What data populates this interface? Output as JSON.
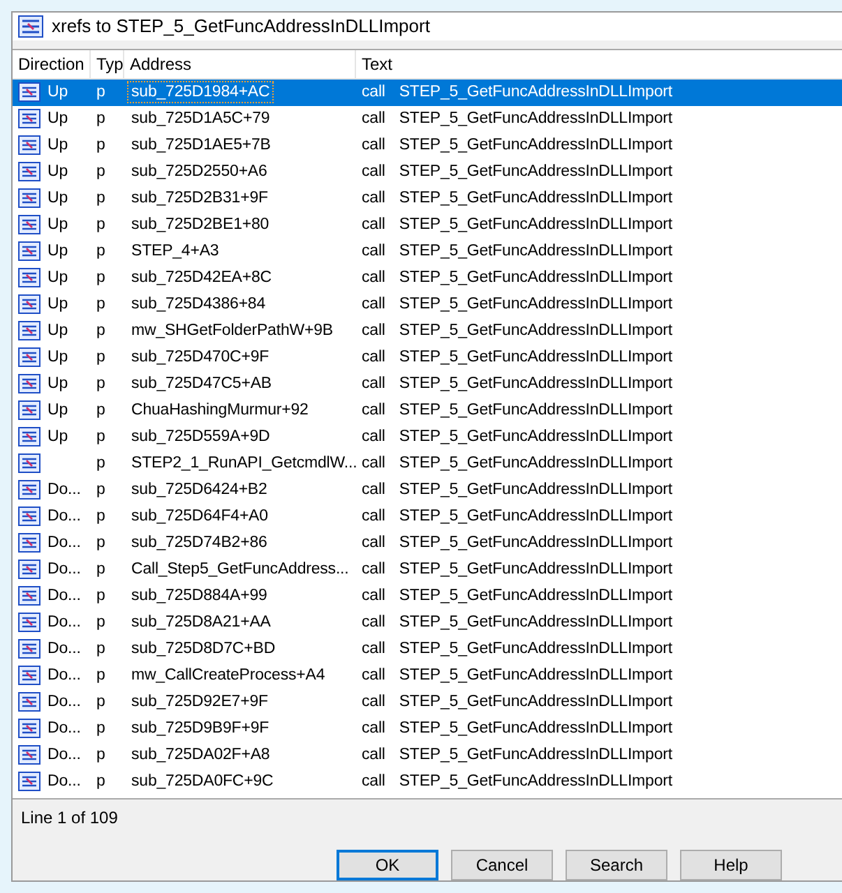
{
  "window": {
    "title": "xrefs to STEP_5_GetFuncAddressInDLLImport"
  },
  "table": {
    "columns": [
      "Direction",
      "Typ",
      "Address",
      "Text"
    ],
    "rows": [
      {
        "direction": "Up",
        "type": "p",
        "address": "sub_725D1984+AC",
        "instruction": "call",
        "target": "STEP_5_GetFuncAddressInDLLImport",
        "selected": true
      },
      {
        "direction": "Up",
        "type": "p",
        "address": "sub_725D1A5C+79",
        "instruction": "call",
        "target": "STEP_5_GetFuncAddressInDLLImport",
        "selected": false
      },
      {
        "direction": "Up",
        "type": "p",
        "address": "sub_725D1AE5+7B",
        "instruction": "call",
        "target": "STEP_5_GetFuncAddressInDLLImport",
        "selected": false
      },
      {
        "direction": "Up",
        "type": "p",
        "address": "sub_725D2550+A6",
        "instruction": "call",
        "target": "STEP_5_GetFuncAddressInDLLImport",
        "selected": false
      },
      {
        "direction": "Up",
        "type": "p",
        "address": "sub_725D2B31+9F",
        "instruction": "call",
        "target": "STEP_5_GetFuncAddressInDLLImport",
        "selected": false
      },
      {
        "direction": "Up",
        "type": "p",
        "address": "sub_725D2BE1+80",
        "instruction": "call",
        "target": "STEP_5_GetFuncAddressInDLLImport",
        "selected": false
      },
      {
        "direction": "Up",
        "type": "p",
        "address": "STEP_4+A3",
        "instruction": "call",
        "target": "STEP_5_GetFuncAddressInDLLImport",
        "selected": false
      },
      {
        "direction": "Up",
        "type": "p",
        "address": "sub_725D42EA+8C",
        "instruction": "call",
        "target": "STEP_5_GetFuncAddressInDLLImport",
        "selected": false
      },
      {
        "direction": "Up",
        "type": "p",
        "address": "sub_725D4386+84",
        "instruction": "call",
        "target": "STEP_5_GetFuncAddressInDLLImport",
        "selected": false
      },
      {
        "direction": "Up",
        "type": "p",
        "address": "mw_SHGetFolderPathW+9B",
        "instruction": "call",
        "target": "STEP_5_GetFuncAddressInDLLImport",
        "selected": false
      },
      {
        "direction": "Up",
        "type": "p",
        "address": "sub_725D470C+9F",
        "instruction": "call",
        "target": "STEP_5_GetFuncAddressInDLLImport",
        "selected": false
      },
      {
        "direction": "Up",
        "type": "p",
        "address": "sub_725D47C5+AB",
        "instruction": "call",
        "target": "STEP_5_GetFuncAddressInDLLImport",
        "selected": false
      },
      {
        "direction": "Up",
        "type": "p",
        "address": "ChuaHashingMurmur+92",
        "instruction": "call",
        "target": "STEP_5_GetFuncAddressInDLLImport",
        "selected": false
      },
      {
        "direction": "Up",
        "type": "p",
        "address": "sub_725D559A+9D",
        "instruction": "call",
        "target": "STEP_5_GetFuncAddressInDLLImport",
        "selected": false
      },
      {
        "type": "p",
        "address": "STEP2_1_RunAPI_GetcmdlW...",
        "instruction": "call",
        "target": "STEP_5_GetFuncAddressInDLLImport",
        "selected": false
      },
      {
        "direction": "Do...",
        "type": "p",
        "address": "sub_725D6424+B2",
        "instruction": "call",
        "target": "STEP_5_GetFuncAddressInDLLImport",
        "selected": false
      },
      {
        "direction": "Do...",
        "type": "p",
        "address": "sub_725D64F4+A0",
        "instruction": "call",
        "target": "STEP_5_GetFuncAddressInDLLImport",
        "selected": false
      },
      {
        "direction": "Do...",
        "type": "p",
        "address": "sub_725D74B2+86",
        "instruction": "call",
        "target": "STEP_5_GetFuncAddressInDLLImport",
        "selected": false
      },
      {
        "direction": "Do...",
        "type": "p",
        "address": "Call_Step5_GetFuncAddress...",
        "instruction": "call",
        "target": "STEP_5_GetFuncAddressInDLLImport",
        "selected": false
      },
      {
        "direction": "Do...",
        "type": "p",
        "address": "sub_725D884A+99",
        "instruction": "call",
        "target": "STEP_5_GetFuncAddressInDLLImport",
        "selected": false
      },
      {
        "direction": "Do...",
        "type": "p",
        "address": "sub_725D8A21+AA",
        "instruction": "call",
        "target": "STEP_5_GetFuncAddressInDLLImport",
        "selected": false
      },
      {
        "direction": "Do...",
        "type": "p",
        "address": "sub_725D8D7C+BD",
        "instruction": "call",
        "target": "STEP_5_GetFuncAddressInDLLImport",
        "selected": false
      },
      {
        "direction": "Do...",
        "type": "p",
        "address": "mw_CallCreateProcess+A4",
        "instruction": "call",
        "target": "STEP_5_GetFuncAddressInDLLImport",
        "selected": false
      },
      {
        "direction": "Do...",
        "type": "p",
        "address": "sub_725D92E7+9F",
        "instruction": "call",
        "target": "STEP_5_GetFuncAddressInDLLImport",
        "selected": false
      },
      {
        "direction": "Do...",
        "type": "p",
        "address": "sub_725D9B9F+9F",
        "instruction": "call",
        "target": "STEP_5_GetFuncAddressInDLLImport",
        "selected": false
      },
      {
        "direction": "Do...",
        "type": "p",
        "address": "sub_725DA02F+A8",
        "instruction": "call",
        "target": "STEP_5_GetFuncAddressInDLLImport",
        "selected": false
      },
      {
        "direction": "Do...",
        "type": "p",
        "address": "sub_725DA0FC+9C",
        "instruction": "call",
        "target": "STEP_5_GetFuncAddressInDLLImport",
        "selected": false
      }
    ]
  },
  "status_bar": "Line 1 of 109",
  "buttons": [
    {
      "label": "OK",
      "default": true
    },
    {
      "label": "Cancel",
      "default": false
    },
    {
      "label": "Search",
      "default": false
    },
    {
      "label": "Help",
      "default": false
    }
  ]
}
